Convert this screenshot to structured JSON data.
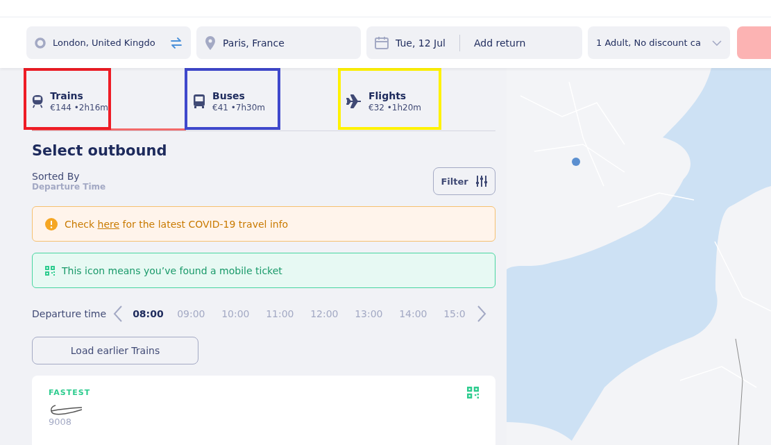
{
  "search": {
    "origin": "London, United Kingdo",
    "destination": "Paris, France",
    "date": "Tue, 12 Jul",
    "return_placeholder": "Add return",
    "passengers": "1 Adult, No discount ca"
  },
  "tabs": [
    {
      "kind": "train",
      "label": "Trains",
      "summary": "€144 •2h16m",
      "selected": true,
      "color": "#ee1c25"
    },
    {
      "kind": "bus",
      "label": "Buses",
      "summary": "€41 •7h30m",
      "selected": false,
      "color": "#3f48cc"
    },
    {
      "kind": "plane",
      "label": "Flights",
      "summary": "€32 •1h20m",
      "selected": false,
      "color": "#fff200"
    }
  ],
  "heading": "Select outbound",
  "sort": {
    "label": "Sorted By",
    "value": "Departure Time"
  },
  "filter_button": "Filter",
  "covid_notice": {
    "before": "Check ",
    "link": "here",
    "after": " for the latest COVID-19 travel info"
  },
  "mobile_notice": "This icon means you’ve found a mobile ticket",
  "departure": {
    "label": "Departure time",
    "times": [
      {
        "label": "08:00",
        "selected": true
      },
      {
        "label": "09:00",
        "selected": false
      },
      {
        "label": "10:00",
        "selected": false
      },
      {
        "label": "11:00",
        "selected": false
      },
      {
        "label": "12:00",
        "selected": false
      },
      {
        "label": "13:00",
        "selected": false
      },
      {
        "label": "14:00",
        "selected": false
      },
      {
        "label": "15:0",
        "selected": false
      }
    ]
  },
  "load_earlier": "Load earlier Trains",
  "result": {
    "badge": "FASTEST",
    "train_number": "9008",
    "mobile_ticket": true
  }
}
